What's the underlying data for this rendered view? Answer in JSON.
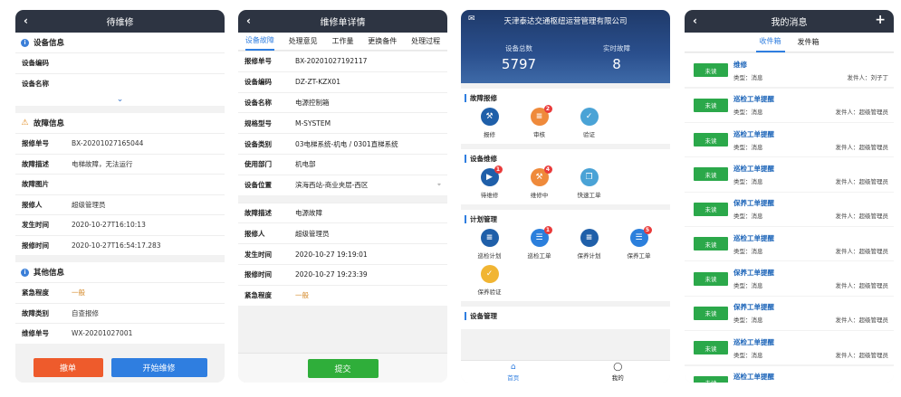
{
  "screen1": {
    "title": "待维修",
    "device_section": "设备信息",
    "device_rows": [
      {
        "label": "设备编码",
        "value": ""
      },
      {
        "label": "设备名称",
        "value": ""
      }
    ],
    "fault_section": "故障信息",
    "fault_rows": [
      {
        "label": "报修单号",
        "value": "BX-20201027165044"
      },
      {
        "label": "故障描述",
        "value": "电梯故障，无法运行"
      },
      {
        "label": "故障图片",
        "value": ""
      },
      {
        "label": "报修人",
        "value": "超级管理员"
      },
      {
        "label": "发生时间",
        "value": "2020-10-27T16:10:13"
      },
      {
        "label": "报修时间",
        "value": "2020-10-27T16:54:17.283"
      }
    ],
    "other_section": "其他信息",
    "other_rows": [
      {
        "label": "紧急程度",
        "value": "一般"
      },
      {
        "label": "故障类别",
        "value": "自查报修"
      },
      {
        "label": "维修单号",
        "value": "WX-20201027001"
      }
    ],
    "cancel_label": "撤单",
    "start_label": "开始维修"
  },
  "screen2": {
    "title": "维修单详情",
    "tabs": [
      "设备故障",
      "处理意见",
      "工作量",
      "更换备件",
      "处理过程"
    ],
    "rows_a": [
      {
        "label": "报修单号",
        "value": "BX-20201027192117"
      },
      {
        "label": "设备编码",
        "value": "DZ-ZT-KZX01"
      },
      {
        "label": "设备名称",
        "value": "电源控制箱"
      },
      {
        "label": "规格型号",
        "value": "M-SYSTEM"
      },
      {
        "label": "设备类别",
        "value": "03电梯系统-机电 / 0301直梯系统"
      },
      {
        "label": "使用部门",
        "value": "机电部"
      },
      {
        "label": "设备位置",
        "value": "滨海西站-商业夹层-西区"
      }
    ],
    "rows_b": [
      {
        "label": "故障描述",
        "value": "电源故障"
      },
      {
        "label": "报修人",
        "value": "超级管理员"
      },
      {
        "label": "发生时间",
        "value": "2020-10-27 19:19:01"
      },
      {
        "label": "报修时间",
        "value": "2020-10-27 19:23:39"
      },
      {
        "label": "紧急程度",
        "value": "一般"
      }
    ],
    "submit_label": "提交"
  },
  "screen3": {
    "company": "天津泰达交通枢纽运营管理有限公司",
    "stat1_label": "设备总数",
    "stat1_value": "5797",
    "stat2_label": "实时故障",
    "stat2_value": "8",
    "sections": [
      {
        "title": "故障报修",
        "items": [
          {
            "name": "报修",
            "badge": ""
          },
          {
            "name": "审核",
            "badge": "2"
          },
          {
            "name": "验证",
            "badge": ""
          }
        ]
      },
      {
        "title": "设备维修",
        "items": [
          {
            "name": "待维修",
            "badge": "1"
          },
          {
            "name": "维修中",
            "badge": "4"
          },
          {
            "name": "快速工单",
            "badge": ""
          }
        ]
      },
      {
        "title": "计划管理",
        "items": [
          {
            "name": "巡检计划",
            "badge": ""
          },
          {
            "name": "巡检工单",
            "badge": "1"
          },
          {
            "name": "保养计划",
            "badge": ""
          },
          {
            "name": "保养工单",
            "badge": "5"
          },
          {
            "name": "保养验证",
            "badge": ""
          }
        ]
      },
      {
        "title": "设备管理",
        "items": []
      }
    ],
    "nav_home": "首页",
    "nav_mine": "我的"
  },
  "screen4": {
    "title": "我的消息",
    "tab_inbox": "收件箱",
    "tab_outbox": "发件箱",
    "messages": [
      {
        "tag": "未读",
        "title": "维修",
        "type": "类型：消息",
        "sender": "发件人：刘子丁"
      },
      {
        "tag": "未读",
        "title": "巡检工单提醒",
        "type": "类型：消息",
        "sender": "发件人：超级管理员"
      },
      {
        "tag": "未读",
        "title": "巡检工单提醒",
        "type": "类型：消息",
        "sender": "发件人：超级管理员"
      },
      {
        "tag": "未读",
        "title": "巡检工单提醒",
        "type": "类型：消息",
        "sender": "发件人：超级管理员"
      },
      {
        "tag": "未读",
        "title": "保养工单提醒",
        "type": "类型：消息",
        "sender": "发件人：超级管理员"
      },
      {
        "tag": "未读",
        "title": "巡检工单提醒",
        "type": "类型：消息",
        "sender": "发件人：超级管理员"
      },
      {
        "tag": "未读",
        "title": "保养工单提醒",
        "type": "类型：消息",
        "sender": "发件人：超级管理员"
      },
      {
        "tag": "未读",
        "title": "保养工单提醒",
        "type": "类型：消息",
        "sender": "发件人：超级管理员"
      },
      {
        "tag": "未读",
        "title": "巡检工单提醒",
        "type": "类型：消息",
        "sender": "发件人：超级管理员"
      },
      {
        "tag": "未读",
        "title": "巡检工单提醒",
        "type": "类型：消息",
        "sender": "发件人：超级管理员"
      }
    ]
  },
  "colors": {
    "header": "#2d3442",
    "accent": "#2f7ee0",
    "cancel": "#ee5b2c",
    "submit": "#2fae3a",
    "unread": "#2ba84a"
  }
}
